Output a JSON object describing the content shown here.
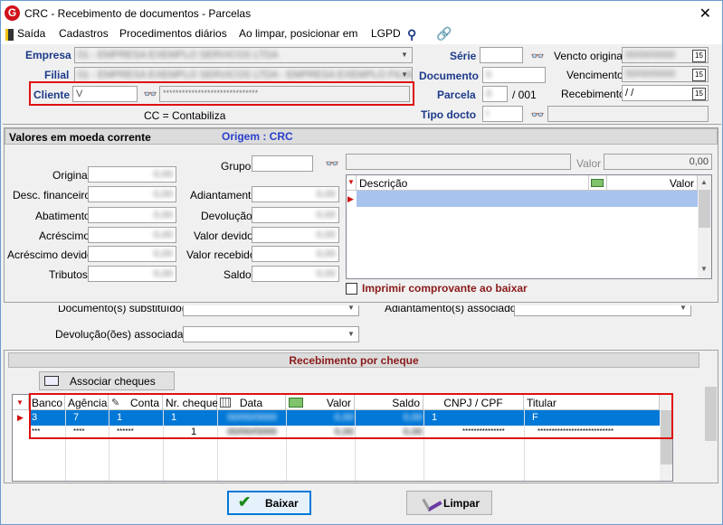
{
  "window": {
    "title": "CRC - Recebimento de documentos - Parcelas",
    "icon_letter": "G",
    "close": "✕"
  },
  "menu": {
    "items": [
      "Saída",
      "Cadastros",
      "Procedimentos diários",
      "Ao limpar, posicionar em",
      "LGPD"
    ]
  },
  "header": {
    "empresa_label": "Empresa",
    "empresa_value": "01 - EMPRESA EXEMPLO SERVICOS LTDA",
    "filial_label": "Filial",
    "filial_value": "01 - EMPRESA EXEMPLO SERVICOS LTDA    -    EMPRESA EXEMPLO FILIAL",
    "cliente_label": "Cliente",
    "cliente_value": "V",
    "cliente_name": "******************************",
    "cc_note": "CC = Contabiliza",
    "serie_label": "Série",
    "documento_label": "Documento",
    "documento_value": "0",
    "parcela_label": "Parcela",
    "parcela_value": "0",
    "parcela_total": "/ 001",
    "tipo_docto_label": "Tipo docto",
    "tipo_docto_value": "I",
    "vencto_original_label": "Vencto original",
    "vencto_original_value": "00/00/0000",
    "vencimento_label": "Vencimento",
    "vencimento_value": "00/00/0000",
    "recebimento_label": "Recebimento",
    "recebimento_value": "/  /",
    "calendar_glyph": "15"
  },
  "values_panel": {
    "title": "Valores em moeda corrente",
    "origem": "Origem : CRC",
    "left_labels": [
      "Original",
      "Desc. financeiro",
      "Abatimento",
      "Acréscimo",
      "Acréscimo devido",
      "Tributos"
    ],
    "left_values": [
      "0,00",
      "0,00",
      "0,00",
      "0,00",
      "0,00",
      "0,00"
    ],
    "mid_labels": [
      "Adiantamento",
      "Devolução",
      "Valor devido",
      "Valor recebido",
      "Saldo"
    ],
    "mid_values": [
      "0,00",
      "0,00",
      "0,00",
      "0,00",
      "0,00"
    ],
    "grupo_label": "Grupo",
    "valor_label": "Valor",
    "valor_value": "0,00",
    "desc_grid_cols": [
      "Descrição",
      "Valor"
    ],
    "print_receipt": "Imprimir comprovante ao baixar"
  },
  "associations": {
    "docs_substituted": "Documento(s) substituído(s)",
    "devolucoes": "Devolução(ões) associada(s)",
    "adiantamentos": "Adiantamento(s) associado(s)"
  },
  "cheque_panel": {
    "title": "Recebimento por cheque",
    "associate_button": "Associar cheques",
    "columns": [
      "Banco",
      "Agência",
      "Conta",
      "Nr. cheque",
      "Data",
      "Valor",
      "Saldo",
      "CNPJ / CPF",
      "Titular"
    ],
    "rows": [
      [
        "3",
        "7",
        "1",
        "1",
        "00/00/0000",
        "0,00",
        "0,00",
        "1",
        "F"
      ],
      [
        "***",
        "****",
        "******",
        "1",
        "00/00/0000",
        "0,00",
        "0,00",
        "***************",
        "***************************"
      ]
    ]
  },
  "footer": {
    "baixar": "Baixar",
    "limpar": "Limpar"
  },
  "colors": {
    "accent_red": "#e01010",
    "label_blue": "#1c3a8a",
    "selection": "#0078d7"
  }
}
